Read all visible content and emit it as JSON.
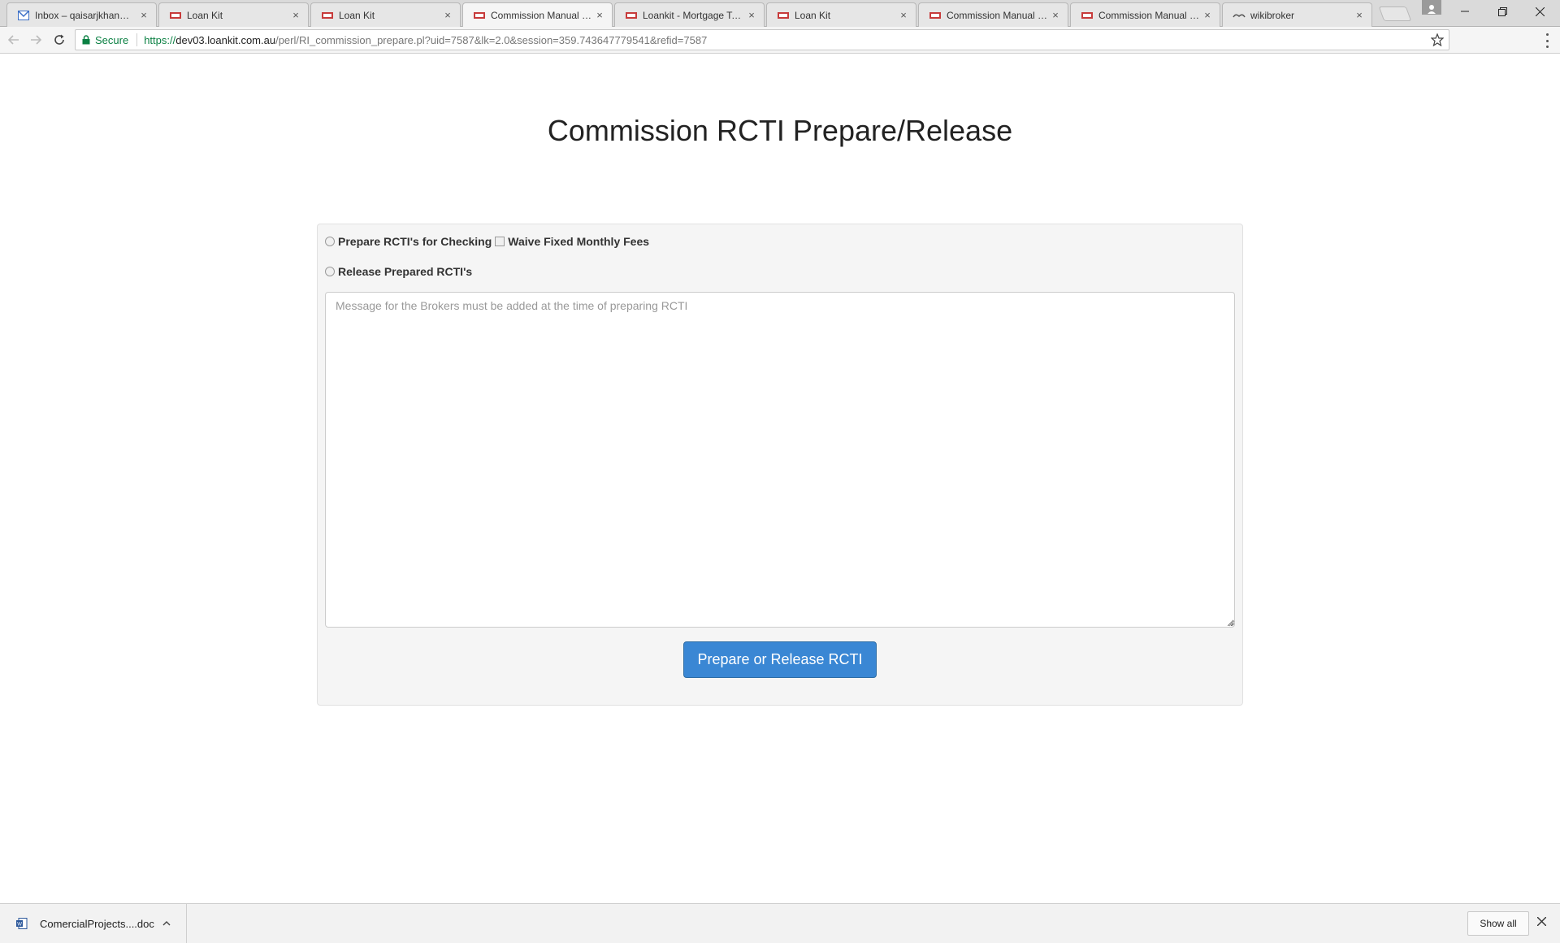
{
  "browser": {
    "tabs": [
      {
        "title": "Inbox – qaisarjkhan@gmail.com",
        "icon": "gmail-icon"
      },
      {
        "title": "Loan Kit",
        "icon": "loankit-icon"
      },
      {
        "title": "Loan Kit",
        "icon": "loankit-icon"
      },
      {
        "title": "Commission Manual Mana",
        "icon": "loankit-icon"
      },
      {
        "title": "Loankit - Mortgage Tools",
        "icon": "loankit-icon"
      },
      {
        "title": "Loan Kit",
        "icon": "loankit-icon"
      },
      {
        "title": "Commission Manual Mana",
        "icon": "loankit-icon"
      },
      {
        "title": "Commission Manual Mana",
        "icon": "loankit-icon"
      },
      {
        "title": "wikibroker",
        "icon": "wikibroker-icon"
      }
    ],
    "active_tab_index": 3,
    "close_glyph": "×",
    "address": {
      "secure_label": "Secure",
      "url_scheme": "https://",
      "url_domain": "dev03.loankit.com.au",
      "url_path": "/perl/RI_commission_prepare.pl?uid=7587&lk=2.0&session=359.743647779541&refid=7587"
    }
  },
  "page": {
    "title": "Commission RCTI Prepare/Release",
    "options": {
      "prepare_label": "Prepare RCTI's for Checking",
      "waive_label": "Waive Fixed Monthly Fees",
      "release_label": "Release Prepared RCTI's"
    },
    "message_placeholder": "Message for the Brokers must be added at the time of preparing RCTI",
    "submit_label": "Prepare or Release RCTI"
  },
  "downloads": {
    "file_name": "ComercialProjects....doc",
    "show_all_label": "Show all"
  },
  "colors": {
    "primary_button": "#3a87d4",
    "secure_green": "#0b8043",
    "panel_bg": "#f5f5f5"
  }
}
